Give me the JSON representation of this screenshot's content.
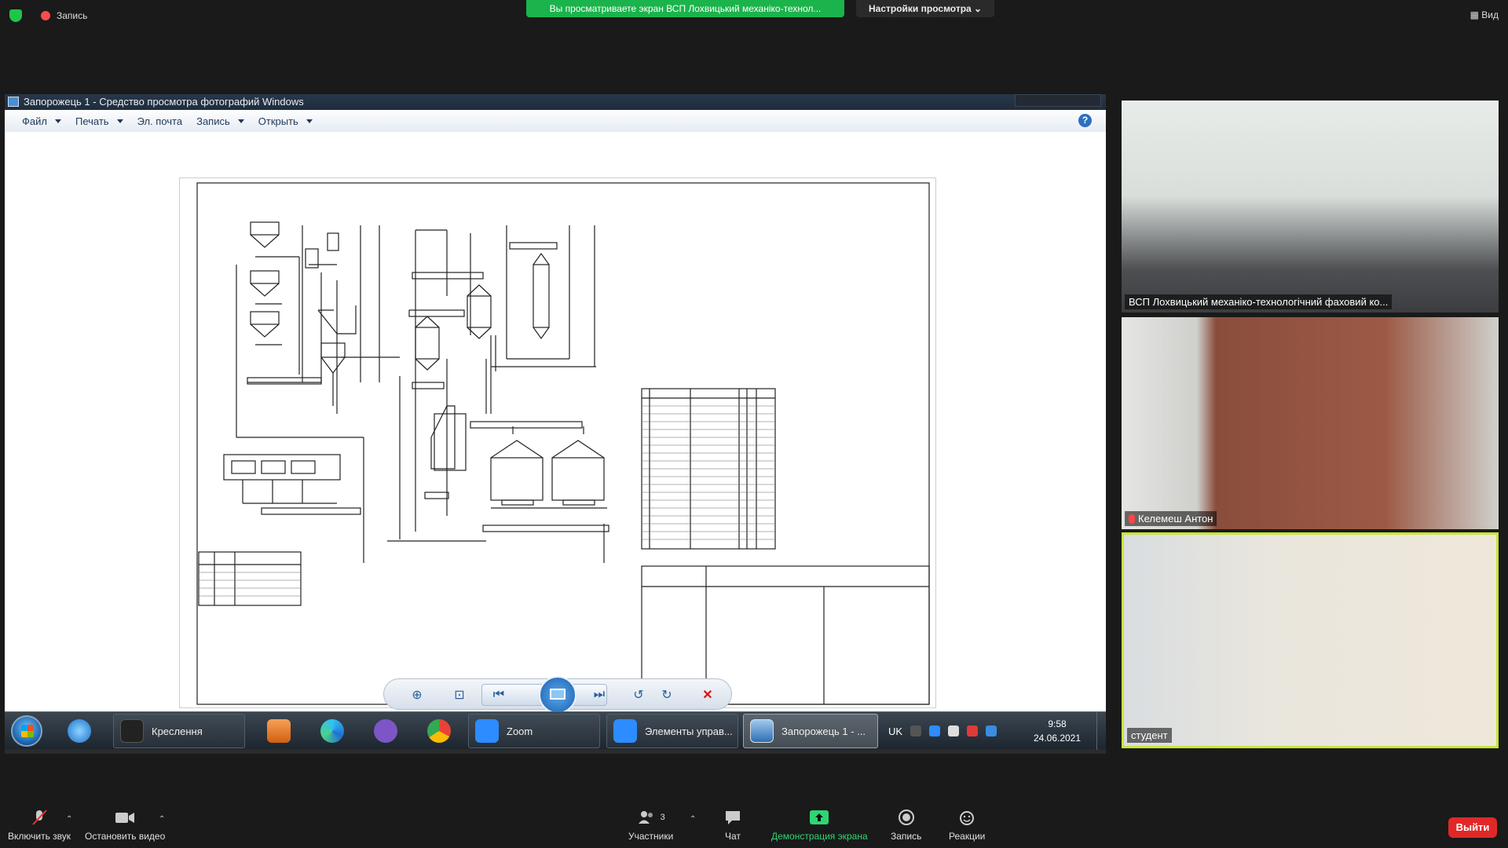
{
  "zoom": {
    "recording_label": "Запись",
    "share_banner": "Вы просматриваете экран ВСП Лохвицький механіко-технол...",
    "view_options": "Настройки просмотра",
    "view_label": "Вид",
    "colors": {
      "share_green": "#1bb34b",
      "leave_red": "#e02828",
      "speaker_border": "#c9e43b"
    }
  },
  "photo_viewer": {
    "title": "Запорожець 1 - Средство просмотра фотографий Windows",
    "menu": [
      {
        "label": "Файл",
        "has_caret": true
      },
      {
        "label": "Печать",
        "has_caret": true
      },
      {
        "label": "Эл. почта",
        "has_caret": false
      },
      {
        "label": "Запись",
        "has_caret": true
      },
      {
        "label": "Открыть",
        "has_caret": true
      }
    ],
    "help": "?",
    "controls": [
      "zoom-icon",
      "fit-icon",
      "previous-icon",
      "slideshow-icon",
      "next-icon",
      "rotate-left-icon",
      "rotate-right-icon",
      "delete-icon"
    ]
  },
  "taskbar": {
    "items": [
      {
        "label": "Креслення",
        "icon": "drawing-app-icon"
      },
      {
        "label": "Zoom",
        "icon": "zoom-app-icon"
      },
      {
        "label": "Элементы управ...",
        "icon": "control-panel-icon"
      },
      {
        "label": "Запорожець 1 - ...",
        "icon": "photo-viewer-icon"
      }
    ],
    "lang": "UK",
    "time": "9:58",
    "date": "24.06.2021"
  },
  "participants": [
    {
      "name": "ВСП Лохвицький механіко-технологічний фаховий ко...",
      "muted": false
    },
    {
      "name": "Келемеш Антон",
      "muted": true
    },
    {
      "name": "студент",
      "muted": false
    }
  ],
  "bottom_bar": {
    "unmute": "Включить звук",
    "stop_video": "Остановить видео",
    "participants": "Участники",
    "participants_count": "3",
    "chat": "Чат",
    "share": "Демонстрация экрана",
    "record": "Запись",
    "reactions": "Реакции",
    "leave": "Выйти"
  }
}
